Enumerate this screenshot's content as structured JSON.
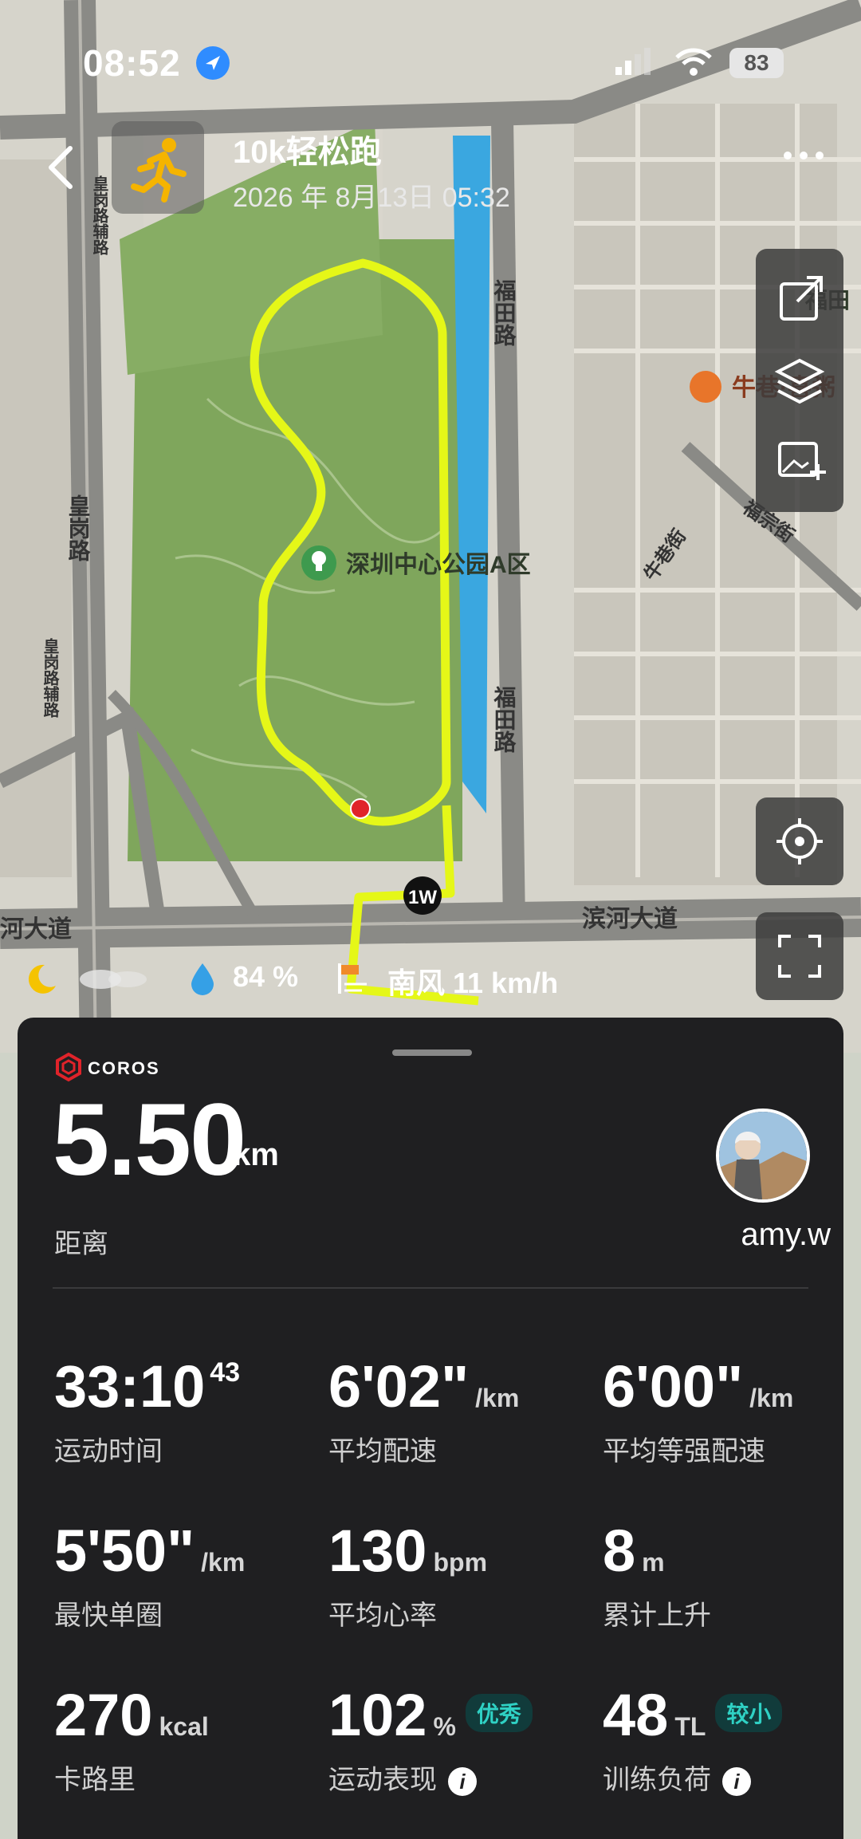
{
  "status_bar": {
    "time": "08:52",
    "battery": "83"
  },
  "header": {
    "title": "10k轻松跑",
    "date": "2026 年 8月13日 05:32"
  },
  "map": {
    "labels": [
      {
        "text": "福田路"
      },
      {
        "text": "福田路"
      },
      {
        "text": "皇岗路"
      },
      {
        "text": "皇岗路辅路"
      },
      {
        "text": "皇岗路辅路"
      },
      {
        "text": "深圳中心公园A区"
      },
      {
        "text": "牛巷·喜粥"
      },
      {
        "text": "福田"
      },
      {
        "text": "牛巷街"
      },
      {
        "text": "福宗街"
      },
      {
        "text": "滨河大道"
      },
      {
        "text": "河大道"
      },
      {
        "text": "1W"
      }
    ]
  },
  "weather": {
    "humidity": "84 %",
    "wind": "南风 11 km/h"
  },
  "summary": {
    "brand": "COROS",
    "distance_value": "5.50",
    "distance_unit": "km",
    "distance_label": "距离",
    "username": "amy.w"
  },
  "stats": [
    {
      "value": "33:10",
      "sup": "43",
      "unit": "",
      "label": "运动时间"
    },
    {
      "value": "6'02\"",
      "unit": "/km",
      "label": "平均配速"
    },
    {
      "value": "6'00\"",
      "unit": "/km",
      "label": "平均等强配速"
    },
    {
      "value": "5'50\"",
      "unit": "/km",
      "label": "最快单圈"
    },
    {
      "value": "130",
      "unit": "bpm",
      "label": "平均心率"
    },
    {
      "value": "8",
      "unit": "m",
      "label": "累计上升"
    },
    {
      "value": "270",
      "unit": "kcal",
      "label": "卡路里"
    },
    {
      "value": "102",
      "unit": "%",
      "badge": "优秀",
      "label": "运动表现"
    },
    {
      "value": "48",
      "unit": "TL",
      "badge": "较小",
      "label": "训练负荷"
    }
  ],
  "colors": {
    "route": "#e5f718",
    "park": "#7fa65c",
    "road": "#8a8a86",
    "water": "#3aa7e0",
    "badge_text": "#2fd1c4",
    "sheet_bg": "#1f1f21"
  }
}
